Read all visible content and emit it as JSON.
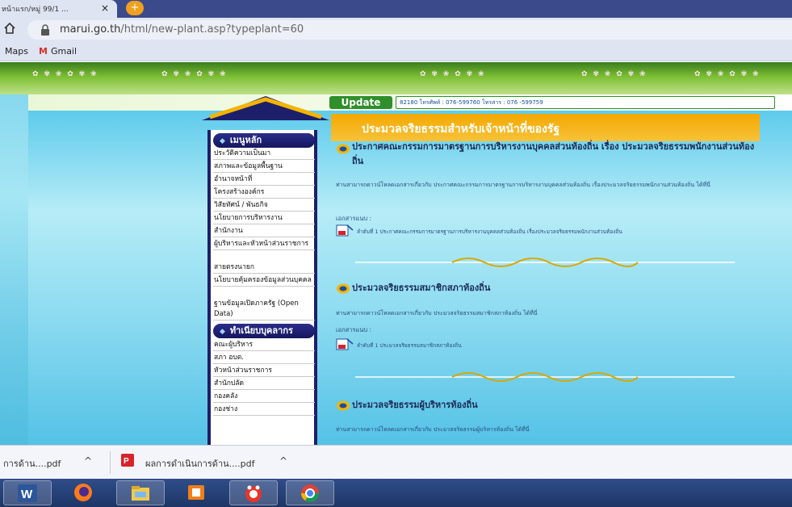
{
  "browser": {
    "tab_title": "หน้าแรก/หมู่ 99/1 ...",
    "tab_close": "×",
    "new_tab": "+",
    "url_domain": "marui.go.th",
    "url_path": "/html/new-plant.asp?typeplant=60",
    "bookmarks": [
      "Maps",
      "Gmail"
    ],
    "gmail_icon": "M"
  },
  "header": {
    "update_label": "Update",
    "update_text": "82180 โทรศัพท์ : 076-599760 โทรสาร : 076 -599759"
  },
  "sidebar": {
    "main_menu": {
      "label": "เมนูหลัก",
      "items": [
        "ประวัติความเป็นมา",
        "สภาพและข้อมูลพื้นฐาน",
        "อำนาจหน้าที่",
        "โครงสร้างองค์กร",
        "วิสัยทัศน์ / พันธกิจ",
        "นโยบายการบริหารงาน",
        "สำนักงาน",
        "ผู้บริหารและหัวหน้าส่วนราชการ",
        "สายตรงนายก",
        "นโยบายคุ้มครองข้อมูลส่วนบุคคล",
        "ฐานข้อมูลเปิดภาครัฐ (Open Data)"
      ]
    },
    "personnel_menu": {
      "label": "ทำเนียบบุคลากร",
      "items": [
        "คณะผู้บริหาร",
        "สภา อบต.",
        "หัวหน้าส่วนราชการ",
        "สำนักปลัด",
        "กองคลัง",
        "กองช่าง"
      ]
    }
  },
  "main": {
    "page_title": "ประมวลจริยธรรมสำหรับเจ้าหน้าที่ของรัฐ",
    "items": [
      {
        "title": "ประกาศคณะกรรมการมาตรฐานการบริหารงานบุคคลส่วนท้องถิ่น เรื่อง ประมวลจริยธรรมพนักงานส่วนท้องถิ่น",
        "desc": "ท่านสามารถดาวน์โหลดเอกสารเกี่ยวกับ ประกาศคณะกรรมการมาตรฐานการบริหารงานบุคคลส่วนท้องถิ่น เรื่องประมวลจริยธรรมพนักงานส่วนท้องถิ่น ได้ที่นี่",
        "attach_label": "เอกสารแนบ :",
        "attachment": "ลำดับที่ 1 ประกาศคณะกรรมการมาตรฐานการบริหารงานบุคคลส่วนท้องถิ่น เรื่องประมวลจริยธรรมพนักงานส่วนท้องถิ่น"
      },
      {
        "title": "ประมวลจริยธรรมสมาชิกสภาท้องถิ่น",
        "desc": "ท่านสามารถดาวน์โหลดเอกสารเกี่ยวกับ ประมวลจริยธรรมสมาชิกสภาท้องถิ่น ได้ที่นี่",
        "attach_label": "เอกสารแนบ :",
        "attachment": "ลำดับที่ 1 ประมวลจริยธรรมสมาชิกสภาท้องถิ่น"
      },
      {
        "title": "ประมวลจริยธรรมผู้บริหารท้องถิ่น",
        "desc": "ท่านสามารถดาวน์โหลดเอกสารเกี่ยวกับ ประมวลจริยธรรมผู้บริหารท้องถิ่น ได้ที่นี่"
      }
    ]
  },
  "downloads": {
    "items": [
      {
        "name": "การด้าน....pdf"
      },
      {
        "name": "ผลการดำเนินการด้าน....pdf"
      }
    ],
    "arrow": "^"
  },
  "taskbar": {
    "apps": [
      "word-icon",
      "firefox-icon",
      "file-explorer-icon",
      "media-player-icon",
      "paint-icon",
      "chrome-icon"
    ]
  },
  "colors": {
    "menu_head": "#15175e",
    "title_bar": "#f5a800",
    "update_green": "#2f8f2a",
    "taskbar": "#1e3666"
  }
}
